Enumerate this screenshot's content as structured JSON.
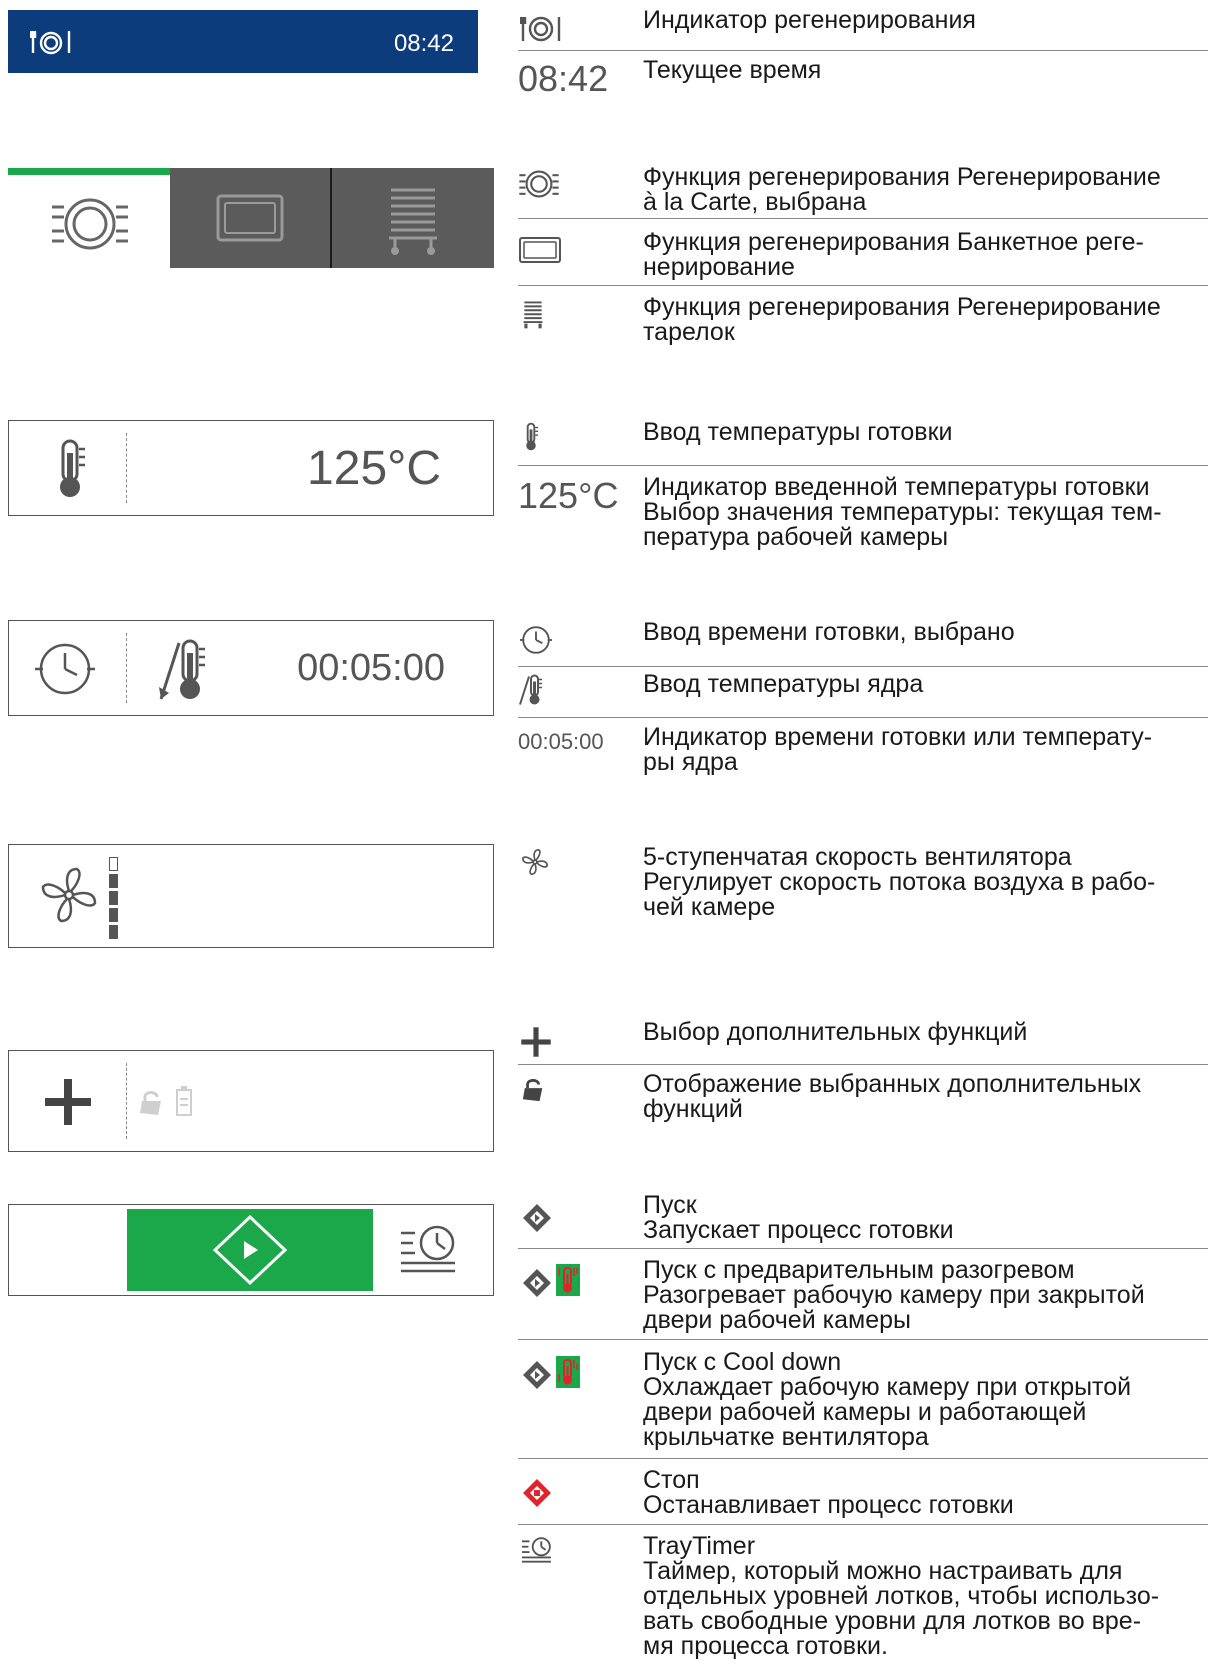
{
  "header": {
    "time": "08:42",
    "bg_color": "#0d3c7d"
  },
  "regen_tabs": [
    {
      "name": "a-la-carte",
      "selected": true
    },
    {
      "name": "banquet",
      "selected": false
    },
    {
      "name": "plate",
      "selected": false
    }
  ],
  "colors": {
    "accent_green": "#1aa84b",
    "tab_dark": "#5b5b5b",
    "stop_red": "#e0242b"
  },
  "temp_panel": {
    "value": "125°C"
  },
  "time_panel": {
    "value": "00:05:00"
  },
  "fan_panel": {
    "levels": 5
  },
  "legend": {
    "time_value": "08:42",
    "temp_value": "125°C",
    "cook_time_value": "00:05:00",
    "items": [
      {
        "id": "regen_indicator",
        "lines": [
          "Индикатор регенерирования"
        ]
      },
      {
        "id": "current_time",
        "lines": [
          "Текущее время"
        ]
      },
      {
        "id": "regen_alacarte",
        "lines": [
          "Функция регенерирования Регенерирование",
          "à la Carte, выбрана"
        ]
      },
      {
        "id": "regen_banquet",
        "lines": [
          "Функция регенерирования Банкетное реге-",
          "нерирование"
        ]
      },
      {
        "id": "regen_plates",
        "lines": [
          "Функция регенерирования Регенерирование",
          "тарелок"
        ]
      },
      {
        "id": "temp_input",
        "lines": [
          "Ввод температуры готовки"
        ]
      },
      {
        "id": "temp_indicator",
        "lines": [
          "Индикатор введенной температуры готовки",
          "Выбор значения температуры: текущая тем-",
          "пература рабочей камеры"
        ]
      },
      {
        "id": "time_input",
        "lines": [
          "Ввод времени готовки, выбрано"
        ]
      },
      {
        "id": "core_temp_input",
        "lines": [
          "Ввод температуры ядра"
        ]
      },
      {
        "id": "time_indicator",
        "lines": [
          "Индикатор времени готовки или температу-",
          "ры ядра"
        ]
      },
      {
        "id": "fan_speed",
        "lines": [
          "5-ступенчатая скорость вентилятора",
          "Регулирует скорость потока воздуха в рабо-",
          "чей камере"
        ]
      },
      {
        "id": "extra_select",
        "lines": [
          "Выбор дополнительных функций"
        ]
      },
      {
        "id": "extra_display",
        "lines": [
          "Отображение выбранных дополнительных",
          "функций"
        ]
      },
      {
        "id": "start",
        "lines": [
          "Пуск",
          "Запускает процесс готовки"
        ]
      },
      {
        "id": "start_preheat",
        "lines": [
          "Пуск с предварительным разогревом",
          "Разогревает рабочую камеру при закрытой",
          "двери рабочей камеры"
        ]
      },
      {
        "id": "start_cooldown",
        "lines": [
          "Пуск с Cool down",
          "Охлаждает рабочую камеру при открытой",
          "двери рабочей камеры и работающей",
          "крыльчатке вентилятора"
        ]
      },
      {
        "id": "stop",
        "lines": [
          "Стоп",
          "Останавливает процесс готовки"
        ]
      },
      {
        "id": "traytimer",
        "lines": [
          "TrayTimer",
          "Таймер, который можно настраивать для",
          "отдельных уровней лотков, чтобы использо-",
          "вать свободные уровни для лотков во вре-",
          "мя процесса готовки."
        ]
      }
    ]
  }
}
